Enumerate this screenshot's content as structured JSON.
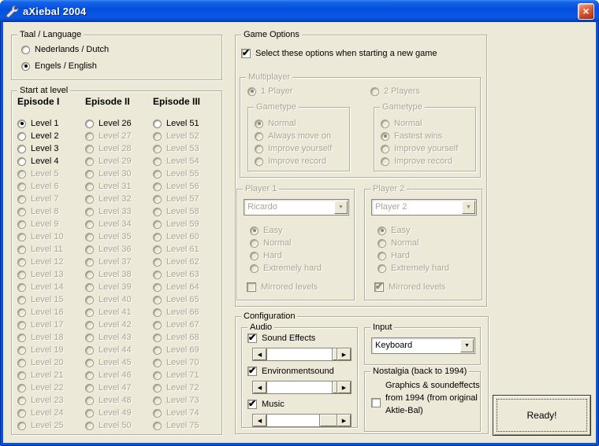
{
  "window": {
    "title": "aXiebal 2004"
  },
  "colors": {
    "form_bg": "#ECE9D8",
    "window_border": "#0855DD",
    "disabled_text": "#A9A694",
    "close_red": "#CC4527"
  },
  "language_group": {
    "title": "Taal / Language",
    "options": [
      {
        "label": "Nederlands / Dutch",
        "enabled": true,
        "selected": false
      },
      {
        "label": "Engels / English",
        "enabled": true,
        "selected": true
      }
    ]
  },
  "start_level_group": {
    "title": "Start at level",
    "episodes": [
      {
        "header": "Episode I",
        "levels": [
          {
            "label": "Level 1",
            "enabled": true,
            "selected": true
          },
          {
            "label": "Level 2",
            "enabled": true
          },
          {
            "label": "Level 3",
            "enabled": true
          },
          {
            "label": "Level 4",
            "enabled": true
          },
          {
            "label": "Level 5",
            "enabled": false
          },
          {
            "label": "Level 6",
            "enabled": false
          },
          {
            "label": "Level 7",
            "enabled": false
          },
          {
            "label": "Level 8",
            "enabled": false
          },
          {
            "label": "Level 9",
            "enabled": false
          },
          {
            "label": "Level 10",
            "enabled": false
          },
          {
            "label": "Level 11",
            "enabled": false
          },
          {
            "label": "Level 12",
            "enabled": false
          },
          {
            "label": "Level 13",
            "enabled": false
          },
          {
            "label": "Level 14",
            "enabled": false
          },
          {
            "label": "Level 15",
            "enabled": false
          },
          {
            "label": "Level 16",
            "enabled": false
          },
          {
            "label": "Level 17",
            "enabled": false
          },
          {
            "label": "Level 18",
            "enabled": false
          },
          {
            "label": "Level 19",
            "enabled": false
          },
          {
            "label": "Level 20",
            "enabled": false
          },
          {
            "label": "Level 21",
            "enabled": false
          },
          {
            "label": "Level 22",
            "enabled": false
          },
          {
            "label": "Level 23",
            "enabled": false
          },
          {
            "label": "Level 24",
            "enabled": false
          },
          {
            "label": "Level 25",
            "enabled": false
          }
        ]
      },
      {
        "header": "Episode II",
        "levels": [
          {
            "label": "Level 26",
            "enabled": true
          },
          {
            "label": "Level 27",
            "enabled": false
          },
          {
            "label": "Level 28",
            "enabled": false
          },
          {
            "label": "Level 29",
            "enabled": false
          },
          {
            "label": "Level 30",
            "enabled": false
          },
          {
            "label": "Level 31",
            "enabled": false
          },
          {
            "label": "Level 32",
            "enabled": false
          },
          {
            "label": "Level 33",
            "enabled": false
          },
          {
            "label": "Level 34",
            "enabled": false
          },
          {
            "label": "Level 35",
            "enabled": false
          },
          {
            "label": "Level 36",
            "enabled": false
          },
          {
            "label": "Level 37",
            "enabled": false
          },
          {
            "label": "Level 38",
            "enabled": false
          },
          {
            "label": "Level 39",
            "enabled": false
          },
          {
            "label": "Level 40",
            "enabled": false
          },
          {
            "label": "Level 41",
            "enabled": false
          },
          {
            "label": "Level 42",
            "enabled": false
          },
          {
            "label": "Level 43",
            "enabled": false
          },
          {
            "label": "Level 44",
            "enabled": false
          },
          {
            "label": "Level 45",
            "enabled": false
          },
          {
            "label": "Level 46",
            "enabled": false
          },
          {
            "label": "Level 47",
            "enabled": false
          },
          {
            "label": "Level 48",
            "enabled": false
          },
          {
            "label": "Level 49",
            "enabled": false
          },
          {
            "label": "Level 50",
            "enabled": false
          }
        ]
      },
      {
        "header": "Episode III",
        "levels": [
          {
            "label": "Level 51",
            "enabled": true
          },
          {
            "label": "Level 52",
            "enabled": false
          },
          {
            "label": "Level 53",
            "enabled": false
          },
          {
            "label": "Level 54",
            "enabled": false
          },
          {
            "label": "Level 55",
            "enabled": false
          },
          {
            "label": "Level 56",
            "enabled": false
          },
          {
            "label": "Level 57",
            "enabled": false
          },
          {
            "label": "Level 58",
            "enabled": false
          },
          {
            "label": "Level 59",
            "enabled": false
          },
          {
            "label": "Level 60",
            "enabled": false
          },
          {
            "label": "Level 61",
            "enabled": false
          },
          {
            "label": "Level 62",
            "enabled": false
          },
          {
            "label": "Level 63",
            "enabled": false
          },
          {
            "label": "Level 64",
            "enabled": false
          },
          {
            "label": "Level 65",
            "enabled": false
          },
          {
            "label": "Level 66",
            "enabled": false
          },
          {
            "label": "Level 67",
            "enabled": false
          },
          {
            "label": "Level 68",
            "enabled": false
          },
          {
            "label": "Level 69",
            "enabled": false
          },
          {
            "label": "Level 70",
            "enabled": false
          },
          {
            "label": "Level 71",
            "enabled": false
          },
          {
            "label": "Level 72",
            "enabled": false
          },
          {
            "label": "Level 73",
            "enabled": false
          },
          {
            "label": "Level 74",
            "enabled": false
          },
          {
            "label": "Level 75",
            "enabled": false
          }
        ]
      }
    ]
  },
  "game_options": {
    "title": "Game Options",
    "autostart": {
      "label": "Select these options when starting a new game",
      "checked": true,
      "enabled": true
    },
    "multiplayer": {
      "title": "Multiplayer",
      "enabled": false,
      "player_count": [
        {
          "label": "1 Player",
          "enabled": false,
          "selected": true
        },
        {
          "label": "2 Players",
          "enabled": false,
          "selected": false
        }
      ],
      "gametype_left": {
        "title": "Gametype",
        "options": [
          {
            "label": "Normal",
            "enabled": false,
            "selected": true
          },
          {
            "label": "Always move on",
            "enabled": false
          },
          {
            "label": "Improve yourself",
            "enabled": false
          },
          {
            "label": "Improve record",
            "enabled": false
          }
        ]
      },
      "gametype_right": {
        "title": "Gametype",
        "options": [
          {
            "label": "Normal",
            "enabled": false
          },
          {
            "label": "Fastest wins",
            "enabled": false,
            "selected": true
          },
          {
            "label": "Improve yourself",
            "enabled": false
          },
          {
            "label": "Improve record",
            "enabled": false
          }
        ]
      }
    },
    "player1": {
      "title": "Player 1",
      "combo_value": "Ricardo",
      "enabled": false,
      "difficulty": [
        {
          "label": "Easy",
          "enabled": false,
          "selected": true
        },
        {
          "label": "Normal",
          "enabled": false
        },
        {
          "label": "Hard",
          "enabled": false
        },
        {
          "label": "Extremely hard",
          "enabled": false
        }
      ],
      "mirrored": {
        "label": "Mirrored levels",
        "checked": false,
        "enabled": false
      }
    },
    "player2": {
      "title": "Player 2",
      "combo_value": "Player 2",
      "enabled": false,
      "difficulty": [
        {
          "label": "Easy",
          "enabled": false,
          "selected": true
        },
        {
          "label": "Normal",
          "enabled": false
        },
        {
          "label": "Hard",
          "enabled": false
        },
        {
          "label": "Extremely hard",
          "enabled": false
        }
      ],
      "mirrored": {
        "label": "Mirrored levels",
        "checked": true,
        "enabled": false
      }
    }
  },
  "configuration": {
    "title": "Configuration",
    "audio": {
      "title": "Audio",
      "items": [
        {
          "label": "Sound Effects",
          "checked": true,
          "thumb_left_frac": 0.93,
          "thumb_width_frac": 0.07
        },
        {
          "label": "Environmentsound",
          "checked": true,
          "thumb_left_frac": 0.93,
          "thumb_width_frac": 0.07
        },
        {
          "label": "Music",
          "checked": true,
          "thumb_left_frac": 0.76,
          "thumb_width_frac": 0.24
        }
      ]
    },
    "input": {
      "title": "Input",
      "combo_value": "Keyboard"
    },
    "nostalgia": {
      "title": "Nostalgia (back to 1994)",
      "checked": false,
      "lines": [
        "Graphics & soundeffects",
        "from 1994 (from original",
        "Aktie-Bal)"
      ]
    }
  },
  "ready_button": {
    "label": "Ready!"
  }
}
